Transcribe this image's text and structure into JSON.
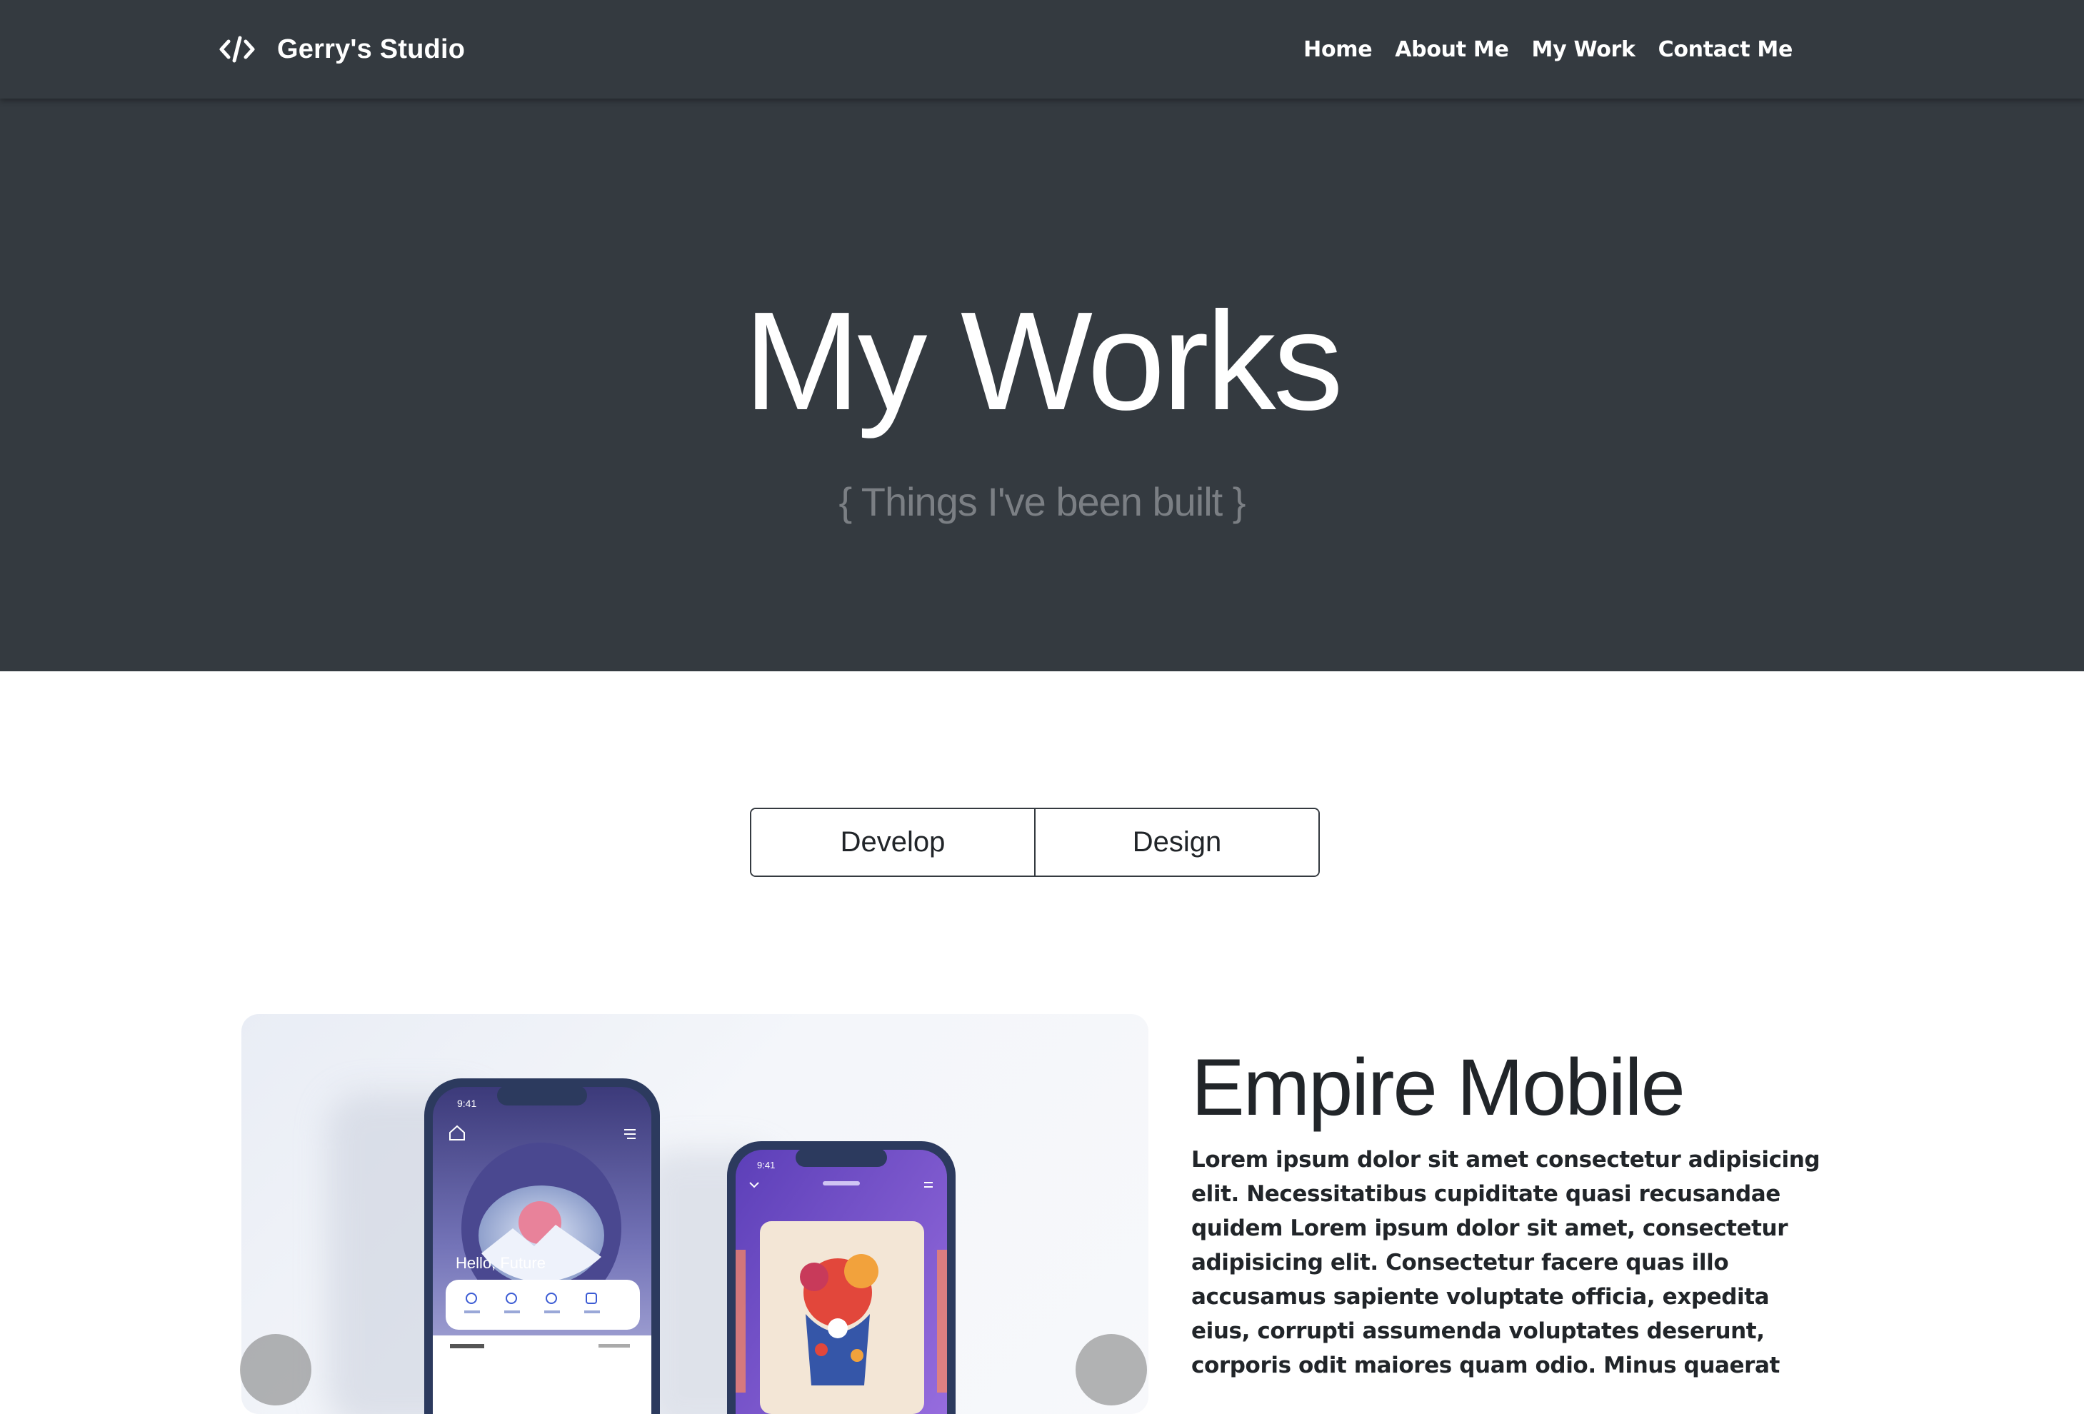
{
  "navbar": {
    "brand_icon": "code-icon",
    "brand_title": "Gerry's Studio",
    "links": [
      {
        "label": "Home"
      },
      {
        "label": "About Me"
      },
      {
        "label": "My Work"
      },
      {
        "label": "Contact Me"
      }
    ]
  },
  "hero": {
    "title": "My Works",
    "subtitle": "{ Things I've been built }"
  },
  "filter": {
    "options": [
      "Develop",
      "Design"
    ]
  },
  "project": {
    "title": "Empire Mobile",
    "description": "Lorem ipsum dolor sit amet consectetur adipisicing elit. Necessitatibus cupiditate quasi recusandae quidem Lorem ipsum dolor sit amet, consectetur adipisicing elit. Consectetur facere quas illo accusamus sapiente voluptate officia, expedita eius, corrupti assumenda voluptates deserunt, corporis odit maiores quam odio. Minus quaerat",
    "phone_left": {
      "time": "9:41",
      "greeting": "Hello, Future"
    },
    "phone_right": {
      "time": "9:41"
    }
  },
  "colors": {
    "navbar_bg": "#343a40",
    "hero_subtitle": "#7b7f84",
    "text_dark": "#212529"
  }
}
